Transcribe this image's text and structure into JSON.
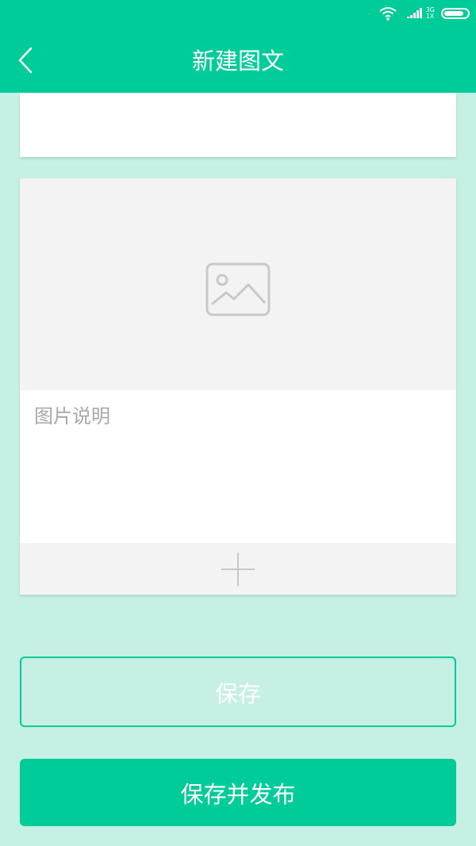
{
  "status_bar": {
    "network_type_top": "3G",
    "network_type_bottom": "1X",
    "icons": [
      "wifi-icon",
      "signal-icon",
      "battery-icon"
    ]
  },
  "header": {
    "title": "新建图文",
    "back_icon": "chevron-left-icon"
  },
  "card": {
    "image_placeholder_icon": "image-icon",
    "caption_placeholder": "图片说明",
    "add_icon": "plus-icon"
  },
  "actions": {
    "save_label": "保存",
    "save_publish_label": "保存并发布"
  },
  "colors": {
    "accent": "#00cc99",
    "background": "#c5f0e3",
    "placeholder_bg": "#f3f3f3",
    "placeholder_text": "#a8a8a8"
  }
}
